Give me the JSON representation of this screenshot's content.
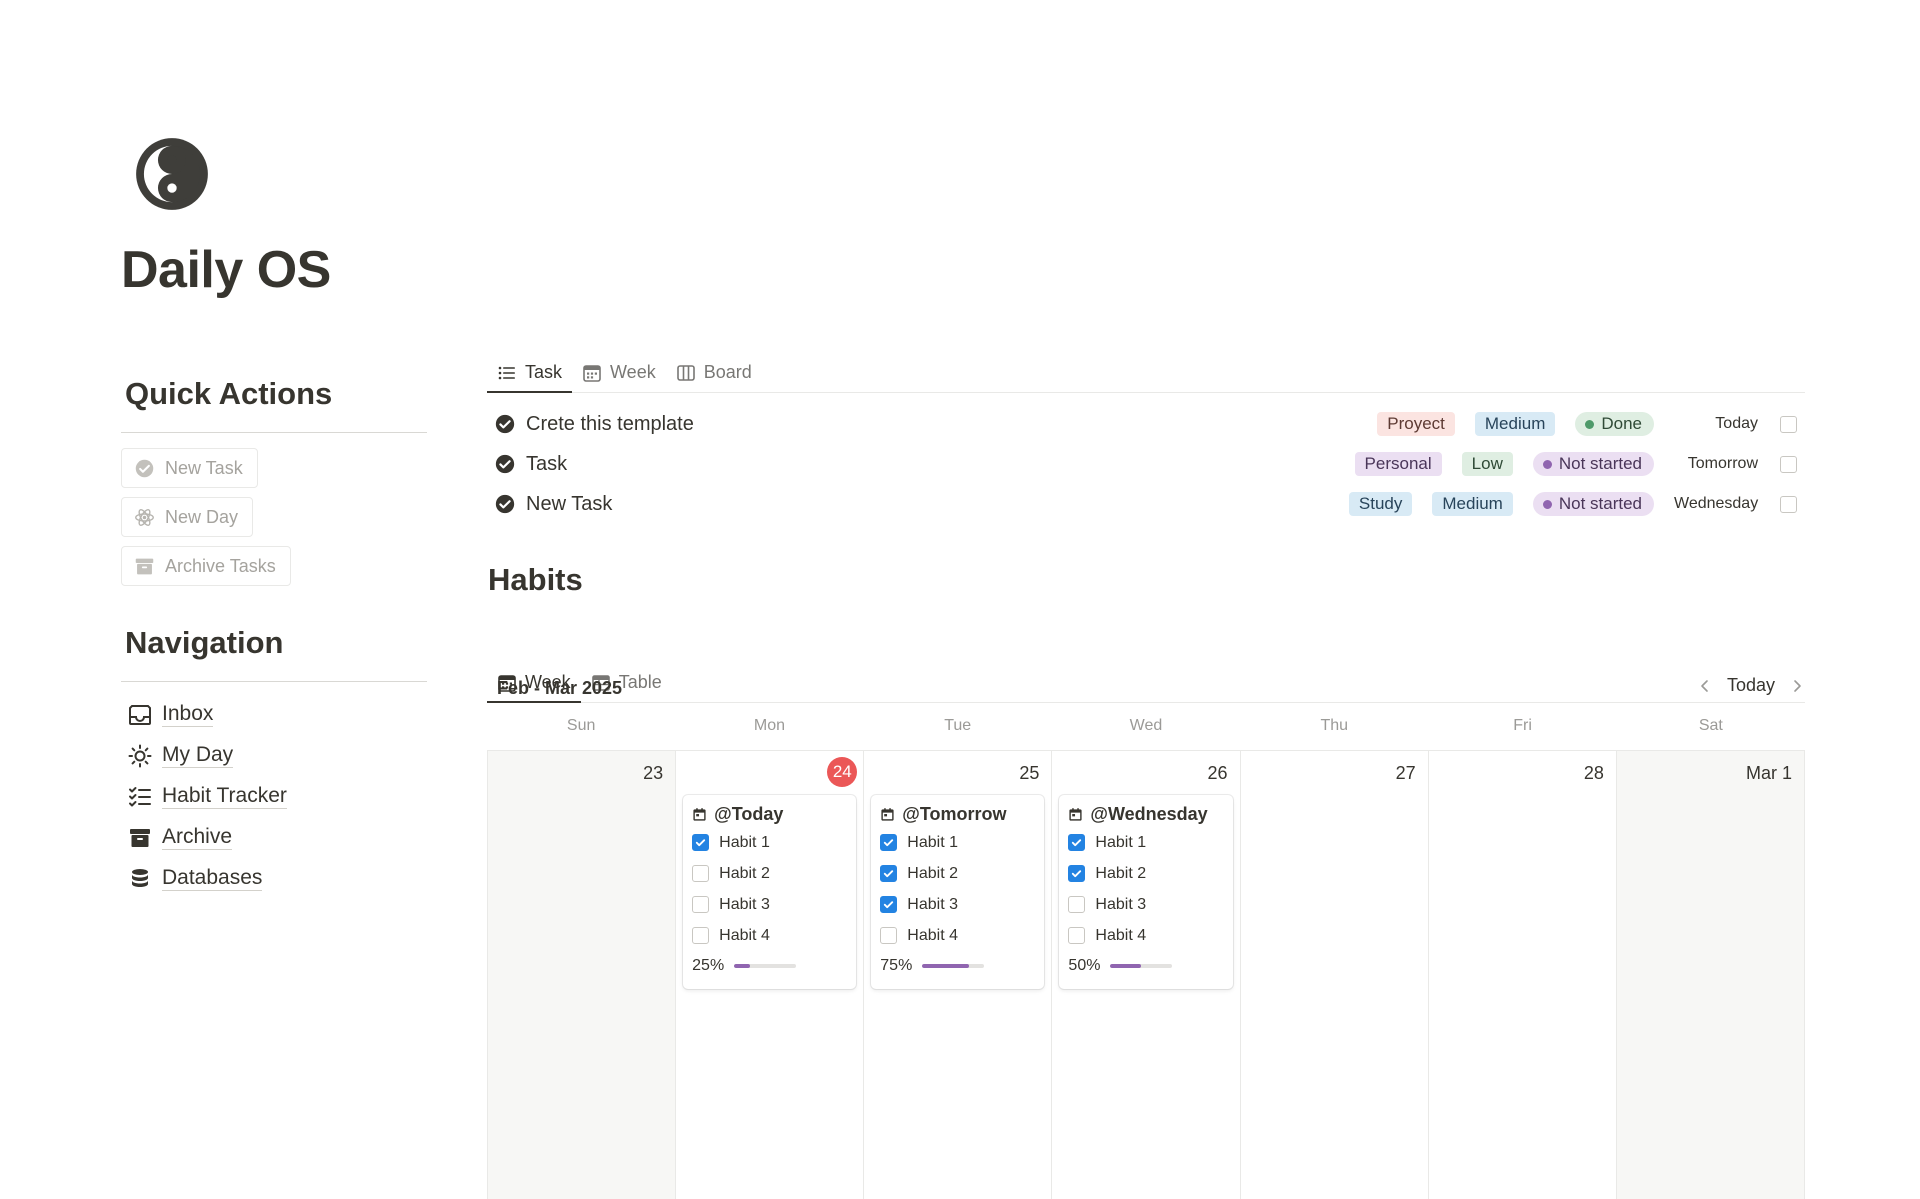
{
  "page": {
    "title": "Daily OS",
    "icon": "yin-yang-icon"
  },
  "quick_actions": {
    "heading": "Quick Actions",
    "buttons": [
      {
        "label": "New Task",
        "icon": "check-circle-icon"
      },
      {
        "label": "New Day",
        "icon": "atom-icon"
      },
      {
        "label": "Archive Tasks",
        "icon": "archive-box-icon"
      }
    ]
  },
  "navigation": {
    "heading": "Navigation",
    "items": [
      {
        "label": "Inbox",
        "icon": "inbox-tray-icon"
      },
      {
        "label": "My Day",
        "icon": "sun-icon"
      },
      {
        "label": "Habit Tracker",
        "icon": "checklist-icon"
      },
      {
        "label": "Archive",
        "icon": "archive-box-icon"
      },
      {
        "label": "Databases",
        "icon": "database-icon"
      }
    ]
  },
  "task_view": {
    "tabs": [
      {
        "label": "Task",
        "icon": "list-icon",
        "active": true
      },
      {
        "label": "Week",
        "icon": "calendar-icon",
        "active": false
      },
      {
        "label": "Board",
        "icon": "board-columns-icon",
        "active": false
      }
    ],
    "tasks": [
      {
        "name": "Crete this template",
        "category": "Proyect",
        "priority": "Medium",
        "status": "Done",
        "date": "Today",
        "checked": false
      },
      {
        "name": "Task",
        "category": "Personal",
        "priority": "Low",
        "status": "Not started",
        "date": "Tomorrow",
        "checked": false
      },
      {
        "name": "New Task",
        "category": "Study",
        "priority": "Medium",
        "status": "Not started",
        "date": "Wednesday",
        "checked": false
      }
    ],
    "colors": {
      "Proyect": {
        "bg": "#fbe4e1",
        "fg": "#5d3a33"
      },
      "Personal": {
        "bg": "#ebdff2",
        "fg": "#4a3659"
      },
      "Study": {
        "bg": "#d8eaf5",
        "fg": "#28445a"
      },
      "Medium": {
        "bg": "#d8eaf5",
        "fg": "#28445a"
      },
      "Low": {
        "bg": "#dfeee2",
        "fg": "#2f4a36"
      },
      "Done": {
        "bg": "#dfeee2",
        "fg": "#2f4a36",
        "dot": "#4f9a6a"
      },
      "Not started": {
        "bg": "#ebdff2",
        "fg": "#4a3659",
        "dot": "#9065b0"
      }
    }
  },
  "habits": {
    "title": "Habits",
    "tabs": [
      {
        "label": "Week",
        "icon": "calendar-icon",
        "active": true
      },
      {
        "label": "Table",
        "icon": "table-icon",
        "active": false
      }
    ],
    "calendar": {
      "range_label": "Feb - Mar 2025",
      "today_button": "Today",
      "weekdays": [
        "Sun",
        "Mon",
        "Tue",
        "Wed",
        "Thu",
        "Fri",
        "Sat"
      ],
      "days": [
        {
          "num": "23",
          "weekend": true,
          "today": false,
          "card": null
        },
        {
          "num": "24",
          "weekend": false,
          "today": true,
          "card": {
            "title": "@Today",
            "habits": [
              {
                "label": "Habit 1",
                "done": true
              },
              {
                "label": "Habit 2",
                "done": false
              },
              {
                "label": "Habit 3",
                "done": false
              },
              {
                "label": "Habit 4",
                "done": false
              }
            ],
            "progress_label": "25%",
            "progress": 0.25
          }
        },
        {
          "num": "25",
          "weekend": false,
          "today": false,
          "card": {
            "title": "@Tomorrow",
            "habits": [
              {
                "label": "Habit 1",
                "done": true
              },
              {
                "label": "Habit 2",
                "done": true
              },
              {
                "label": "Habit 3",
                "done": true
              },
              {
                "label": "Habit 4",
                "done": false
              }
            ],
            "progress_label": "75%",
            "progress": 0.75
          }
        },
        {
          "num": "26",
          "weekend": false,
          "today": false,
          "card": {
            "title": "@Wednesday",
            "habits": [
              {
                "label": "Habit 1",
                "done": true
              },
              {
                "label": "Habit 2",
                "done": true
              },
              {
                "label": "Habit 3",
                "done": false
              },
              {
                "label": "Habit 4",
                "done": false
              }
            ],
            "progress_label": "50%",
            "progress": 0.5
          }
        },
        {
          "num": "27",
          "weekend": false,
          "today": false,
          "card": null
        },
        {
          "num": "28",
          "weekend": false,
          "today": false,
          "card": null
        },
        {
          "num": "Mar 1",
          "weekend": true,
          "today": false,
          "card": null
        }
      ]
    }
  }
}
